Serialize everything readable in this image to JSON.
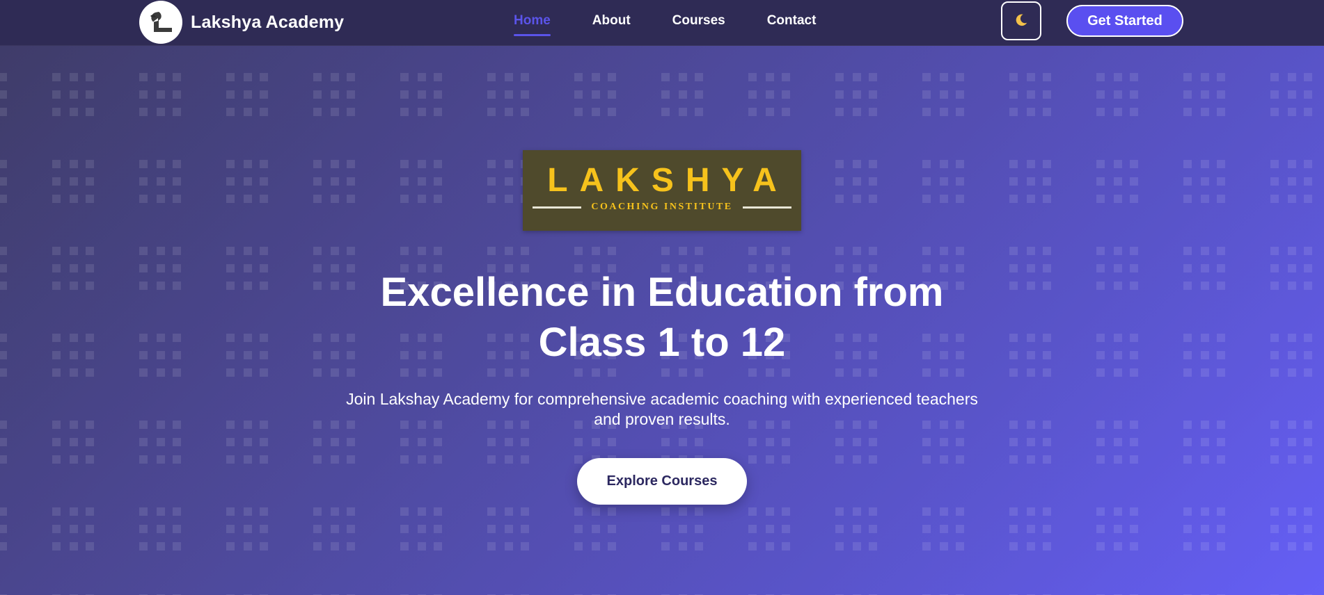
{
  "navbar": {
    "brand_name": "Lakshya Academy",
    "links": [
      {
        "label": "Home",
        "active": true
      },
      {
        "label": "About",
        "active": false
      },
      {
        "label": "Courses",
        "active": false
      },
      {
        "label": "Contact",
        "active": false
      }
    ],
    "theme_toggle_icon": "moon-icon",
    "cta_label": "Get Started"
  },
  "hero": {
    "logo_word": "LAKSHYA",
    "logo_subtitle": "COACHING INSTITUTE",
    "title_line1": "Excellence in Education from",
    "title_line2": "Class 1 to 12",
    "subtitle_line1": "Join Lakshay Academy for comprehensive academic coaching with experienced teachers",
    "subtitle_line2": "and proven results.",
    "button_label": "Explore Courses"
  },
  "colors": {
    "navbar_bg": "#2f2b55",
    "accent": "#5b54ea",
    "cta_bg": "#5a4ff0",
    "logo_gold": "#f6c21c",
    "logo_bg": "#4f4a2c",
    "gradient_start": "#2b2857",
    "gradient_end": "#564ff5"
  }
}
